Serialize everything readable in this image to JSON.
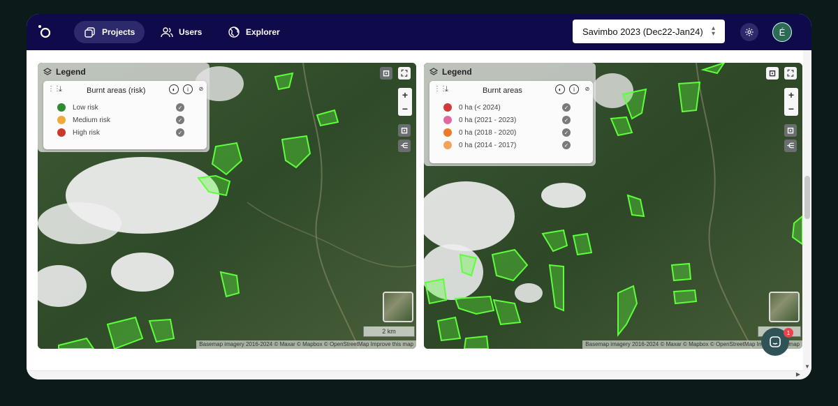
{
  "nav": {
    "items": [
      {
        "label": "Projects",
        "icon": "projects-icon",
        "active": true
      },
      {
        "label": "Users",
        "icon": "users-icon",
        "active": false
      },
      {
        "label": "Explorer",
        "icon": "globe-icon",
        "active": false
      }
    ],
    "project_select": "Savimbo 2023 (Dec22-Jan24)",
    "avatar_initial": "É"
  },
  "map_left": {
    "legend_title": "Legend",
    "layer_title": "Burnt areas (risk)",
    "items": [
      {
        "label": "Low risk",
        "color": "#2e8b2e"
      },
      {
        "label": "Medium risk",
        "color": "#f2a93b"
      },
      {
        "label": "High risk",
        "color": "#c73a2a"
      }
    ],
    "scale": "2 km",
    "attribution": "Basemap imagery 2016-2024 © Maxar © Mapbox © OpenStreetMap Improve this map"
  },
  "map_right": {
    "legend_title": "Legend",
    "layer_title": "Burnt areas",
    "items": [
      {
        "label": "0 ha (< 2024)",
        "color": "#d23a3a"
      },
      {
        "label": "0 ha (2021 - 2023)",
        "color": "#e06aa0"
      },
      {
        "label": "0 ha (2018 - 2020)",
        "color": "#ec7a2b"
      },
      {
        "label": "0 ha (2014 - 2017)",
        "color": "#f2a35a"
      }
    ],
    "attribution": "Basemap imagery 2016-2024 © Maxar © Mapbox © OpenStreetMap Improve this map"
  },
  "chat": {
    "badge": "1"
  },
  "colors": {
    "topbar": "#0f0a4a",
    "polygon": "#5cff3a"
  }
}
